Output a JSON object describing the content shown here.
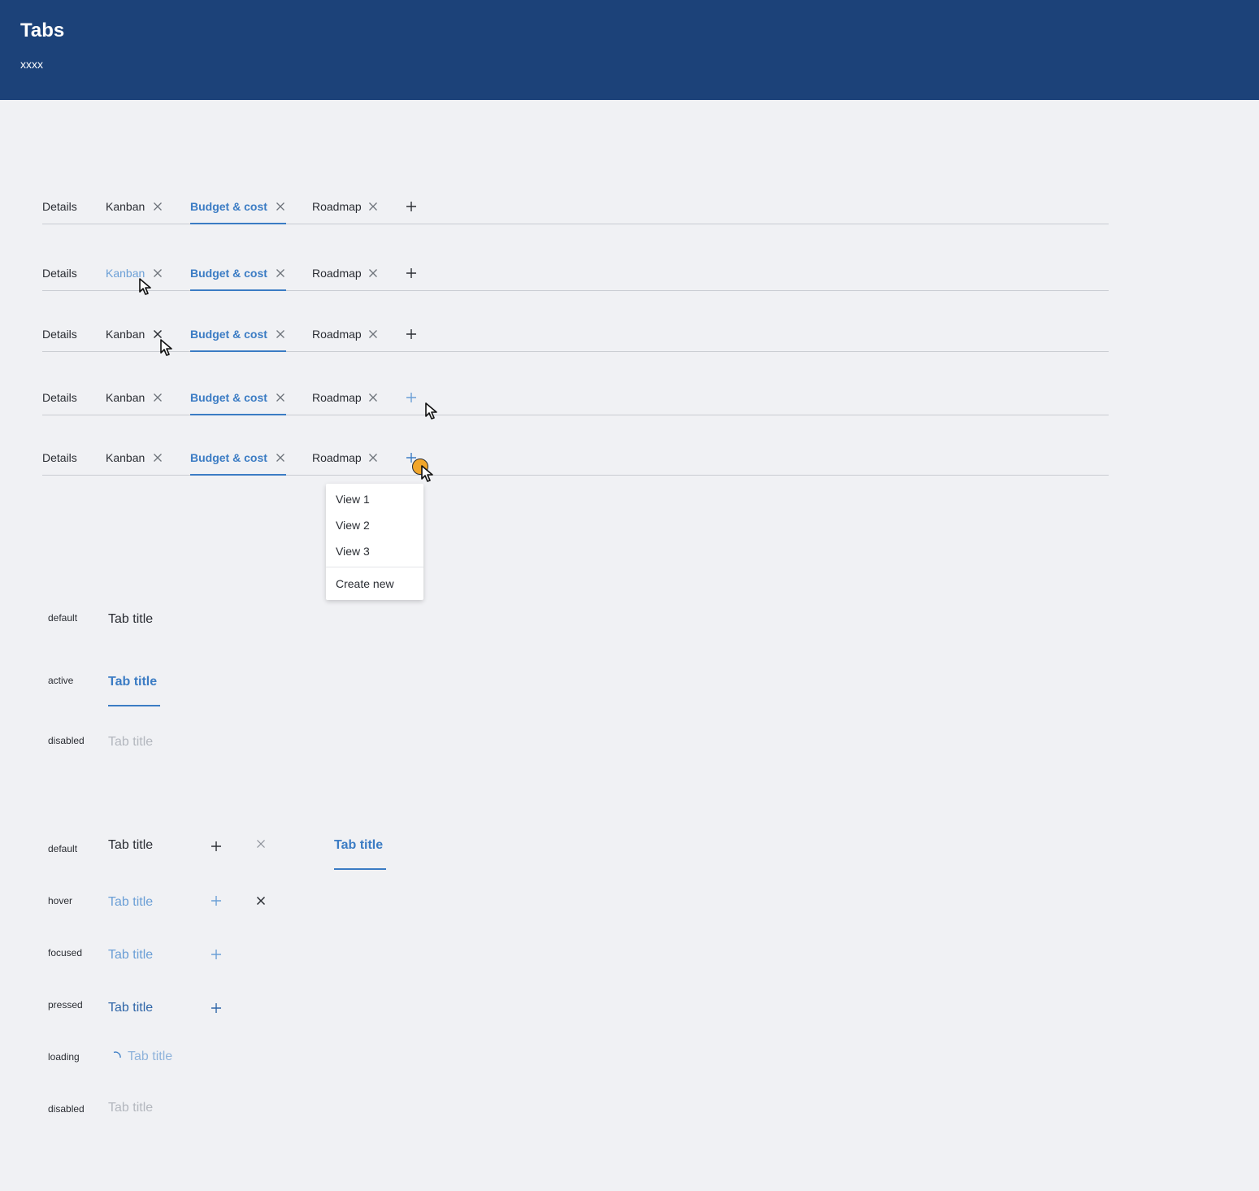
{
  "header": {
    "title": "Tabs",
    "subtitle": "xxxx"
  },
  "tab_rows": [
    {
      "state": "default",
      "tabs": [
        {
          "label": "Details",
          "closable": false
        },
        {
          "label": "Kanban",
          "closable": true
        },
        {
          "label": "Budget & cost",
          "closable": true,
          "active": true
        },
        {
          "label": "Roadmap",
          "closable": true
        }
      ]
    },
    {
      "state": "hover-tab",
      "tabs": [
        {
          "label": "Details",
          "closable": false
        },
        {
          "label": "Kanban",
          "closable": true,
          "hovered": true
        },
        {
          "label": "Budget & cost",
          "closable": true,
          "active": true
        },
        {
          "label": "Roadmap",
          "closable": true
        }
      ]
    },
    {
      "state": "hover-close",
      "tabs": [
        {
          "label": "Details",
          "closable": false
        },
        {
          "label": "Kanban",
          "closable": true
        },
        {
          "label": "Budget & cost",
          "closable": true,
          "active": true
        },
        {
          "label": "Roadmap",
          "closable": true
        }
      ]
    },
    {
      "state": "hover-add",
      "tabs": [
        {
          "label": "Details",
          "closable": false
        },
        {
          "label": "Kanban",
          "closable": true
        },
        {
          "label": "Budget & cost",
          "closable": true,
          "active": true
        },
        {
          "label": "Roadmap",
          "closable": true
        }
      ]
    },
    {
      "state": "pressed-add",
      "tabs": [
        {
          "label": "Details",
          "closable": false
        },
        {
          "label": "Kanban",
          "closable": true
        },
        {
          "label": "Budget & cost",
          "closable": true,
          "active": true
        },
        {
          "label": "Roadmap",
          "closable": true
        }
      ]
    }
  ],
  "dropdown_menu": {
    "items": [
      "View 1",
      "View 2",
      "View 3"
    ],
    "create_label": "Create new"
  },
  "tab_states": {
    "default_label": "default",
    "active_label": "active",
    "disabled_label": "disabled",
    "tab_text": "Tab title"
  },
  "button_states": {
    "default_label": "default",
    "hover_label": "hover",
    "focused_label": "focused",
    "pressed_label": "pressed",
    "loading_label": "loading",
    "disabled_label": "disabled",
    "tab_text": "Tab title"
  },
  "colors": {
    "header_bg": "#1c4279",
    "page_bg": "#f0f1f4",
    "accent": "#3b7cc4",
    "hover": "#6b9fd6",
    "disabled": "#b3b7be",
    "pressed_indicator": "#f1a62b"
  },
  "icons": [
    "close-icon",
    "plus-icon",
    "cursor-icon",
    "spinner-icon"
  ]
}
